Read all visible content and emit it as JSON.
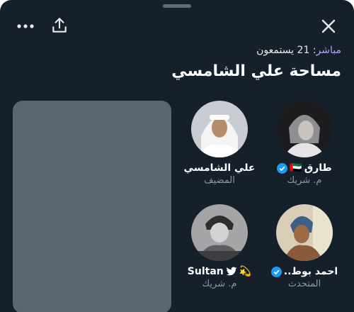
{
  "header": {
    "live_label": "مباشر",
    "listeners_count": "21",
    "listeners_label": "يستمعون",
    "title": "مساحة علي الشامسي"
  },
  "speakers": [
    {
      "name": "طارق",
      "flag": "🇦🇪",
      "role": "م. شريك",
      "verified": true
    },
    {
      "name": "علي الشامسي",
      "role": "المضيف",
      "verified": false
    },
    {
      "name": "احمد بوط..",
      "role": "المتحدث",
      "verified": true
    },
    {
      "name": "Sultan",
      "emoji": "💫",
      "role": "م. شريك",
      "verified": false
    }
  ],
  "colors": {
    "sheet_bg": "#15202b",
    "live_accent": "#b7a2ff",
    "verified_blue": "#1d9bf0",
    "muted_text": "#8b98a5",
    "preview_card": "#5b6770"
  },
  "icons": [
    "more-icon",
    "share-icon",
    "close-icon",
    "verified-icon",
    "twitter-bird-icon"
  ]
}
